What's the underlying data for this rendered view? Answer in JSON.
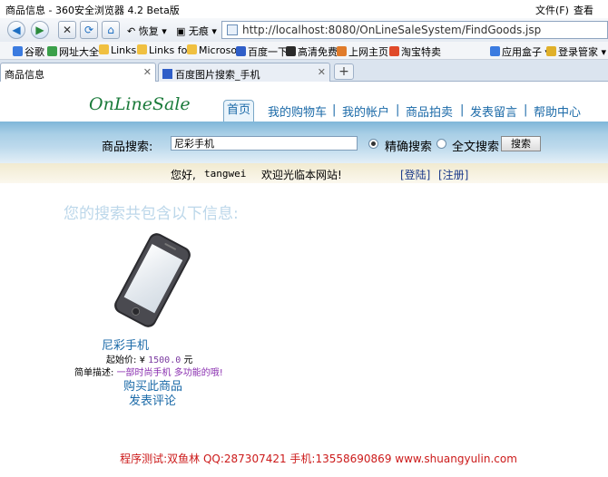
{
  "window": {
    "title": "商品信息 - 360安全浏览器 4.2 Beta版",
    "menu": [
      "文件(F)",
      "查看(V)"
    ]
  },
  "toolbar": {
    "restore_label": "恢复",
    "trace_label": "无痕",
    "url": "http://localhost:8080/OnLineSaleSystem/FindGoods.jsp"
  },
  "bookmarks": {
    "items": [
      "谷歌",
      "网址大全",
      "Links",
      "Links fo",
      "Microso",
      "百度一下",
      "高清免费",
      "上网主页",
      "淘宝特卖"
    ],
    "right": [
      "应用盒子",
      "登录管家"
    ]
  },
  "tabs": [
    {
      "label": "商品信息",
      "active": true
    },
    {
      "label": "百度图片搜索_手机",
      "active": false
    }
  ],
  "site": {
    "logo": "OnLineSale",
    "nav": [
      "首页",
      "我的购物车",
      "我的帐户",
      "商品拍卖",
      "发表留言",
      "帮助中心"
    ],
    "separator": "|"
  },
  "search": {
    "label": "商品搜索:",
    "value": "尼彩手机",
    "options": [
      "精确搜索",
      "全文搜索"
    ],
    "selected": "精确搜索",
    "button": "搜索"
  },
  "welcome": {
    "greeting": "您好,",
    "user": "tangwei",
    "message": "欢迎光临本网站!",
    "login": "[登陆]",
    "register": "[注册]"
  },
  "results": {
    "title": "您的搜索共包含以下信息:",
    "product": {
      "name": "尼彩手机",
      "price_label": "起始价:",
      "currency": "¥",
      "price": "1500.0",
      "unit": "元",
      "desc_label": "简单描述:",
      "desc": "一部时尚手机 多功能的哦!",
      "buy": "购买此商品",
      "comment": "发表评论"
    }
  },
  "footer": "程序测试:双鱼林 QQ:287307421 手机:13558690869 www.shuangyulin.com",
  "colors": {
    "link": "#1b6aa8",
    "footer": "#cc1a1a",
    "logo": "#1a7a3a"
  }
}
